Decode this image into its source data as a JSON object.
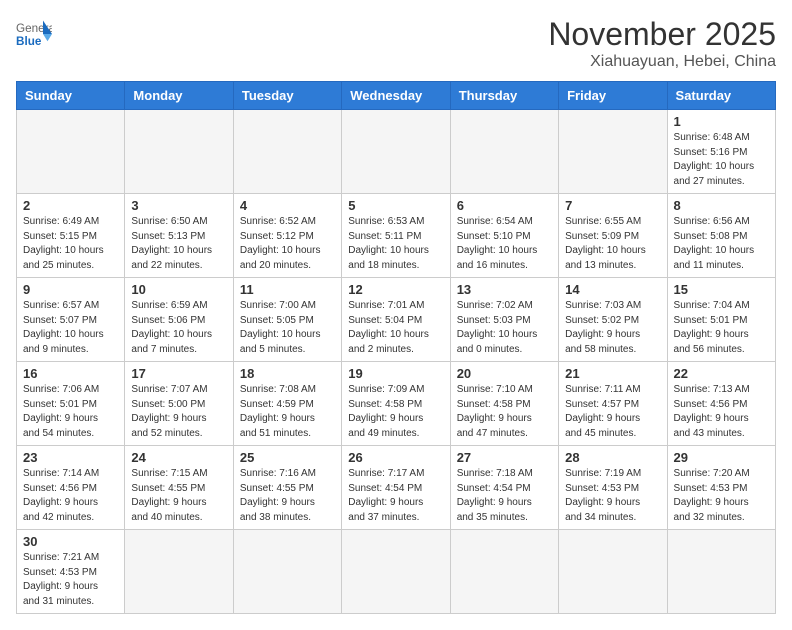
{
  "logo": {
    "general": "General",
    "blue": "Blue"
  },
  "title": "November 2025",
  "location": "Xiahuayuan, Hebei, China",
  "weekdays": [
    "Sunday",
    "Monday",
    "Tuesday",
    "Wednesday",
    "Thursday",
    "Friday",
    "Saturday"
  ],
  "weeks": [
    [
      {
        "day": "",
        "info": ""
      },
      {
        "day": "",
        "info": ""
      },
      {
        "day": "",
        "info": ""
      },
      {
        "day": "",
        "info": ""
      },
      {
        "day": "",
        "info": ""
      },
      {
        "day": "",
        "info": ""
      },
      {
        "day": "1",
        "info": "Sunrise: 6:48 AM\nSunset: 5:16 PM\nDaylight: 10 hours\nand 27 minutes."
      }
    ],
    [
      {
        "day": "2",
        "info": "Sunrise: 6:49 AM\nSunset: 5:15 PM\nDaylight: 10 hours\nand 25 minutes."
      },
      {
        "day": "3",
        "info": "Sunrise: 6:50 AM\nSunset: 5:13 PM\nDaylight: 10 hours\nand 22 minutes."
      },
      {
        "day": "4",
        "info": "Sunrise: 6:52 AM\nSunset: 5:12 PM\nDaylight: 10 hours\nand 20 minutes."
      },
      {
        "day": "5",
        "info": "Sunrise: 6:53 AM\nSunset: 5:11 PM\nDaylight: 10 hours\nand 18 minutes."
      },
      {
        "day": "6",
        "info": "Sunrise: 6:54 AM\nSunset: 5:10 PM\nDaylight: 10 hours\nand 16 minutes."
      },
      {
        "day": "7",
        "info": "Sunrise: 6:55 AM\nSunset: 5:09 PM\nDaylight: 10 hours\nand 13 minutes."
      },
      {
        "day": "8",
        "info": "Sunrise: 6:56 AM\nSunset: 5:08 PM\nDaylight: 10 hours\nand 11 minutes."
      }
    ],
    [
      {
        "day": "9",
        "info": "Sunrise: 6:57 AM\nSunset: 5:07 PM\nDaylight: 10 hours\nand 9 minutes."
      },
      {
        "day": "10",
        "info": "Sunrise: 6:59 AM\nSunset: 5:06 PM\nDaylight: 10 hours\nand 7 minutes."
      },
      {
        "day": "11",
        "info": "Sunrise: 7:00 AM\nSunset: 5:05 PM\nDaylight: 10 hours\nand 5 minutes."
      },
      {
        "day": "12",
        "info": "Sunrise: 7:01 AM\nSunset: 5:04 PM\nDaylight: 10 hours\nand 2 minutes."
      },
      {
        "day": "13",
        "info": "Sunrise: 7:02 AM\nSunset: 5:03 PM\nDaylight: 10 hours\nand 0 minutes."
      },
      {
        "day": "14",
        "info": "Sunrise: 7:03 AM\nSunset: 5:02 PM\nDaylight: 9 hours\nand 58 minutes."
      },
      {
        "day": "15",
        "info": "Sunrise: 7:04 AM\nSunset: 5:01 PM\nDaylight: 9 hours\nand 56 minutes."
      }
    ],
    [
      {
        "day": "16",
        "info": "Sunrise: 7:06 AM\nSunset: 5:01 PM\nDaylight: 9 hours\nand 54 minutes."
      },
      {
        "day": "17",
        "info": "Sunrise: 7:07 AM\nSunset: 5:00 PM\nDaylight: 9 hours\nand 52 minutes."
      },
      {
        "day": "18",
        "info": "Sunrise: 7:08 AM\nSunset: 4:59 PM\nDaylight: 9 hours\nand 51 minutes."
      },
      {
        "day": "19",
        "info": "Sunrise: 7:09 AM\nSunset: 4:58 PM\nDaylight: 9 hours\nand 49 minutes."
      },
      {
        "day": "20",
        "info": "Sunrise: 7:10 AM\nSunset: 4:58 PM\nDaylight: 9 hours\nand 47 minutes."
      },
      {
        "day": "21",
        "info": "Sunrise: 7:11 AM\nSunset: 4:57 PM\nDaylight: 9 hours\nand 45 minutes."
      },
      {
        "day": "22",
        "info": "Sunrise: 7:13 AM\nSunset: 4:56 PM\nDaylight: 9 hours\nand 43 minutes."
      }
    ],
    [
      {
        "day": "23",
        "info": "Sunrise: 7:14 AM\nSunset: 4:56 PM\nDaylight: 9 hours\nand 42 minutes."
      },
      {
        "day": "24",
        "info": "Sunrise: 7:15 AM\nSunset: 4:55 PM\nDaylight: 9 hours\nand 40 minutes."
      },
      {
        "day": "25",
        "info": "Sunrise: 7:16 AM\nSunset: 4:55 PM\nDaylight: 9 hours\nand 38 minutes."
      },
      {
        "day": "26",
        "info": "Sunrise: 7:17 AM\nSunset: 4:54 PM\nDaylight: 9 hours\nand 37 minutes."
      },
      {
        "day": "27",
        "info": "Sunrise: 7:18 AM\nSunset: 4:54 PM\nDaylight: 9 hours\nand 35 minutes."
      },
      {
        "day": "28",
        "info": "Sunrise: 7:19 AM\nSunset: 4:53 PM\nDaylight: 9 hours\nand 34 minutes."
      },
      {
        "day": "29",
        "info": "Sunrise: 7:20 AM\nSunset: 4:53 PM\nDaylight: 9 hours\nand 32 minutes."
      }
    ],
    [
      {
        "day": "30",
        "info": "Sunrise: 7:21 AM\nSunset: 4:53 PM\nDaylight: 9 hours\nand 31 minutes."
      },
      {
        "day": "",
        "info": ""
      },
      {
        "day": "",
        "info": ""
      },
      {
        "day": "",
        "info": ""
      },
      {
        "day": "",
        "info": ""
      },
      {
        "day": "",
        "info": ""
      },
      {
        "day": "",
        "info": ""
      }
    ]
  ]
}
